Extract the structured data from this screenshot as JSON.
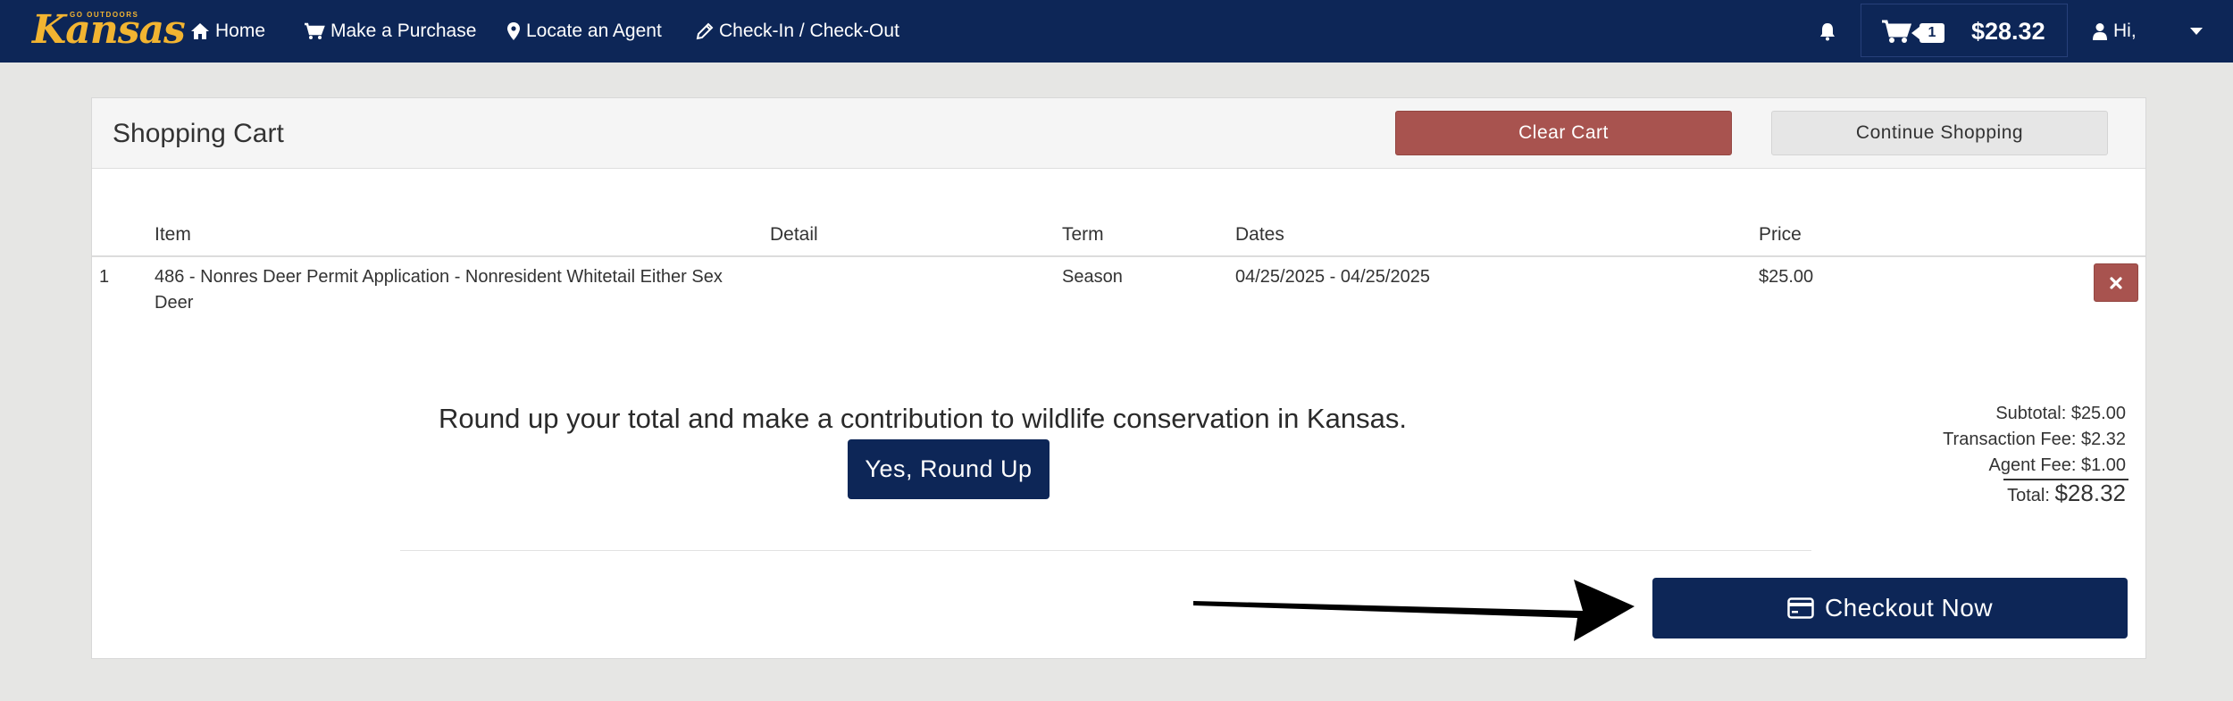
{
  "brand": {
    "tagline": "GO OUTDOORS",
    "name": "Kansas",
    "colors": {
      "nav": "#0d2657",
      "accent": "#f2b431",
      "danger": "#a8534f"
    }
  },
  "nav": {
    "items": [
      {
        "label": "Home",
        "icon": "home-icon"
      },
      {
        "label": "Make a Purchase",
        "icon": "cart-icon"
      },
      {
        "label": "Locate an Agent",
        "icon": "map-marker-icon"
      },
      {
        "label": "Check-In / Check-Out",
        "icon": "pencil-icon"
      }
    ],
    "cart_count": "1",
    "cart_total": "$28.32",
    "user_greeting": "Hi,"
  },
  "cart": {
    "title": "Shopping Cart",
    "clear_label": "Clear Cart",
    "continue_label": "Continue Shopping",
    "columns": [
      "Item",
      "Detail",
      "Term",
      "Dates",
      "Price"
    ],
    "rows": [
      {
        "index": "1",
        "item": "486 - Nonres Deer Permit Application - Nonresident Whitetail Either Sex Deer",
        "detail": "",
        "term": "Season",
        "dates": "04/25/2025 - 04/25/2025",
        "price": "$25.00"
      }
    ],
    "roundup_text": "Round up your total and make a contribution to wildlife conservation in Kansas.",
    "roundup_button": "Yes, Round Up",
    "summary": {
      "subtotal": "Subtotal: $25.00",
      "transaction_fee": "Transaction Fee: $2.32",
      "agent_fee": "Agent Fee: $1.00",
      "total_label": "Total:",
      "total_value": "$28.32"
    },
    "checkout_label": "Checkout Now"
  }
}
